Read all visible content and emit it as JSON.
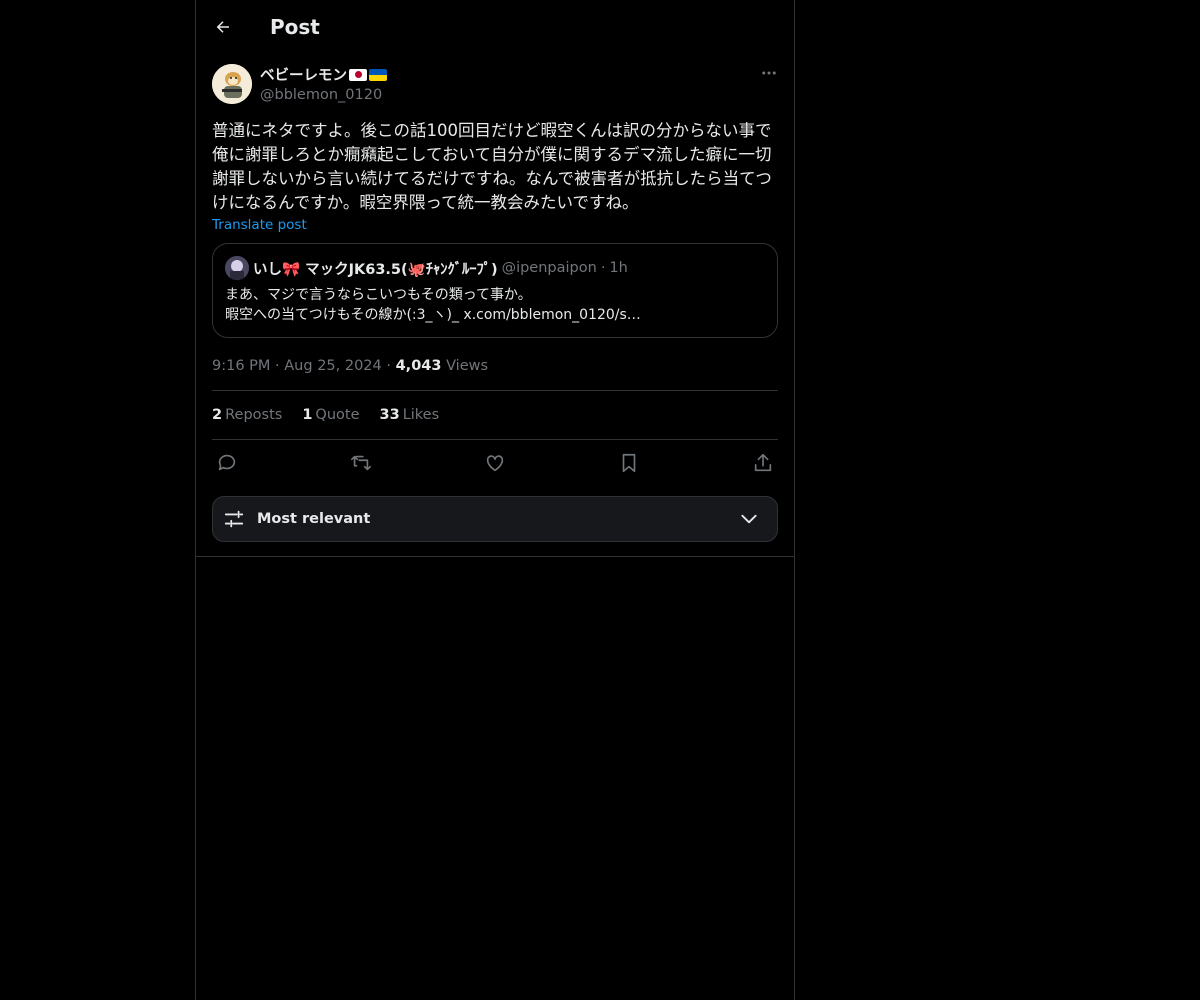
{
  "header": {
    "title": "Post"
  },
  "post": {
    "display_name": "ベビーレモン",
    "handle": "@bblemon_0120",
    "text": "普通にネタですよ。後この話100回目だけど暇空くんは訳の分からない事で俺に謝罪しろとか癇癪起こしておいて自分が僕に関するデマ流した癖に一切謝罪しないから言い続けてるだけですね。なんで被害者が抵抗したら当てつけになるんですか。暇空界隈って統一教会みたいですね。",
    "translate_label": "Translate post",
    "quote": {
      "name": "いし🎀 マックJK63.5(🐙ﾁｬﾝｸﾞﾙｰﾌﾟ)",
      "handle": "@ipenpaipon",
      "dot": "·",
      "time": "1h",
      "line1": "まあ、マジで言うならこいつもその類って事か。",
      "line2": "暇空への当てつけもその線か(:3_ヽ)_ x.com/bblemon_0120/s…"
    },
    "time": "9:16 PM",
    "date": "Aug 25, 2024",
    "views_count": "4,043",
    "views_label": "Views",
    "sep": "·"
  },
  "stats": {
    "reposts_count": "2",
    "reposts_label": "Reposts",
    "quote_count": "1",
    "quote_label": "Quote",
    "likes_count": "33",
    "likes_label": "Likes"
  },
  "sort": {
    "label": "Most relevant"
  },
  "icons": {
    "back": "arrow-left-icon",
    "more": "more-dots-icon",
    "reply": "reply-icon",
    "repost": "repost-icon",
    "like": "heart-icon",
    "bookmark": "bookmark-icon",
    "share": "share-icon",
    "sort": "sliders-icon",
    "chevron": "chevron-down-icon"
  },
  "colors": {
    "background": "#000000",
    "text": "#e7e9ea",
    "muted": "#71767b",
    "link": "#1d9bf0",
    "border": "#2f3336"
  }
}
